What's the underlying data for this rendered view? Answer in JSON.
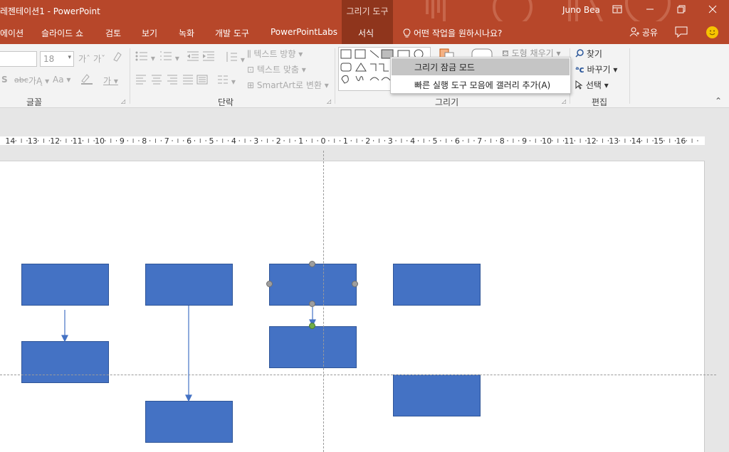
{
  "title_bar": {
    "title": "레젠테이션1  -  PowerPoint",
    "contextual_label": "그리기 도구",
    "user": "Juno Bea"
  },
  "tabs": [
    "에이션",
    "슬라이드 쇼",
    "검토",
    "보기",
    "녹화",
    "개발 도구",
    "PowerPointLabs",
    "서식"
  ],
  "active_tab": "서식",
  "tell_me": "어떤 작업을 원하시나요?",
  "share": "공유",
  "ribbon": {
    "font_size": "18",
    "groups": [
      "글꼴",
      "단락",
      "그리기",
      "편집"
    ],
    "text_direction": "텍스트 방향",
    "text_align": "텍스트 맞춤",
    "smartart": "SmartArt로 변환",
    "shape_fill": "도형 채우기",
    "find": "찾기",
    "replace": "바꾸기",
    "select": "선택"
  },
  "dropdown": {
    "items": [
      "그리기 잠금 모드",
      "빠른 실행 도구 모음에 갤러리 추가(A)"
    ],
    "highlighted_index": 0
  },
  "ruler": {
    "labels": [
      "14",
      "13",
      "12",
      "11",
      "10",
      "9",
      "8",
      "7",
      "6",
      "5",
      "4",
      "3",
      "2",
      "1",
      "0",
      "1",
      "2",
      "3",
      "4",
      "5",
      "6",
      "7",
      "8",
      "9",
      "10",
      "11",
      "12",
      "13",
      "14",
      "15",
      "16"
    ]
  },
  "colors": {
    "accent": "#b7472a",
    "contextual": "#8f351c",
    "shape_fill": "#4472c4",
    "shape_border": "#2f5597",
    "connector": "#4472c4"
  }
}
